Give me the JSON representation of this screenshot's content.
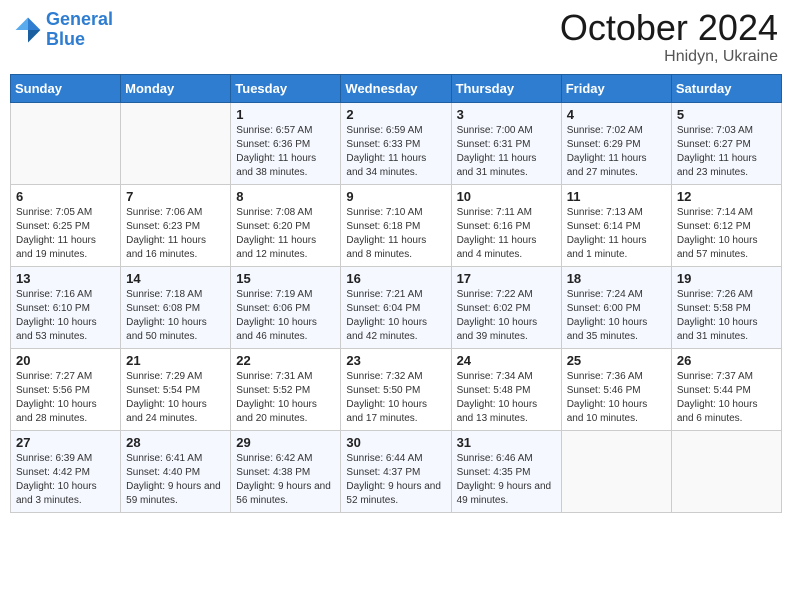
{
  "logo": {
    "text_general": "General",
    "text_blue": "Blue"
  },
  "header": {
    "month": "October 2024",
    "location": "Hnidyn, Ukraine"
  },
  "weekdays": [
    "Sunday",
    "Monday",
    "Tuesday",
    "Wednesday",
    "Thursday",
    "Friday",
    "Saturday"
  ],
  "weeks": [
    [
      {
        "day": "",
        "sunrise": "",
        "sunset": "",
        "daylight": ""
      },
      {
        "day": "",
        "sunrise": "",
        "sunset": "",
        "daylight": ""
      },
      {
        "day": "1",
        "sunrise": "Sunrise: 6:57 AM",
        "sunset": "Sunset: 6:36 PM",
        "daylight": "Daylight: 11 hours and 38 minutes."
      },
      {
        "day": "2",
        "sunrise": "Sunrise: 6:59 AM",
        "sunset": "Sunset: 6:33 PM",
        "daylight": "Daylight: 11 hours and 34 minutes."
      },
      {
        "day": "3",
        "sunrise": "Sunrise: 7:00 AM",
        "sunset": "Sunset: 6:31 PM",
        "daylight": "Daylight: 11 hours and 31 minutes."
      },
      {
        "day": "4",
        "sunrise": "Sunrise: 7:02 AM",
        "sunset": "Sunset: 6:29 PM",
        "daylight": "Daylight: 11 hours and 27 minutes."
      },
      {
        "day": "5",
        "sunrise": "Sunrise: 7:03 AM",
        "sunset": "Sunset: 6:27 PM",
        "daylight": "Daylight: 11 hours and 23 minutes."
      }
    ],
    [
      {
        "day": "6",
        "sunrise": "Sunrise: 7:05 AM",
        "sunset": "Sunset: 6:25 PM",
        "daylight": "Daylight: 11 hours and 19 minutes."
      },
      {
        "day": "7",
        "sunrise": "Sunrise: 7:06 AM",
        "sunset": "Sunset: 6:23 PM",
        "daylight": "Daylight: 11 hours and 16 minutes."
      },
      {
        "day": "8",
        "sunrise": "Sunrise: 7:08 AM",
        "sunset": "Sunset: 6:20 PM",
        "daylight": "Daylight: 11 hours and 12 minutes."
      },
      {
        "day": "9",
        "sunrise": "Sunrise: 7:10 AM",
        "sunset": "Sunset: 6:18 PM",
        "daylight": "Daylight: 11 hours and 8 minutes."
      },
      {
        "day": "10",
        "sunrise": "Sunrise: 7:11 AM",
        "sunset": "Sunset: 6:16 PM",
        "daylight": "Daylight: 11 hours and 4 minutes."
      },
      {
        "day": "11",
        "sunrise": "Sunrise: 7:13 AM",
        "sunset": "Sunset: 6:14 PM",
        "daylight": "Daylight: 11 hours and 1 minute."
      },
      {
        "day": "12",
        "sunrise": "Sunrise: 7:14 AM",
        "sunset": "Sunset: 6:12 PM",
        "daylight": "Daylight: 10 hours and 57 minutes."
      }
    ],
    [
      {
        "day": "13",
        "sunrise": "Sunrise: 7:16 AM",
        "sunset": "Sunset: 6:10 PM",
        "daylight": "Daylight: 10 hours and 53 minutes."
      },
      {
        "day": "14",
        "sunrise": "Sunrise: 7:18 AM",
        "sunset": "Sunset: 6:08 PM",
        "daylight": "Daylight: 10 hours and 50 minutes."
      },
      {
        "day": "15",
        "sunrise": "Sunrise: 7:19 AM",
        "sunset": "Sunset: 6:06 PM",
        "daylight": "Daylight: 10 hours and 46 minutes."
      },
      {
        "day": "16",
        "sunrise": "Sunrise: 7:21 AM",
        "sunset": "Sunset: 6:04 PM",
        "daylight": "Daylight: 10 hours and 42 minutes."
      },
      {
        "day": "17",
        "sunrise": "Sunrise: 7:22 AM",
        "sunset": "Sunset: 6:02 PM",
        "daylight": "Daylight: 10 hours and 39 minutes."
      },
      {
        "day": "18",
        "sunrise": "Sunrise: 7:24 AM",
        "sunset": "Sunset: 6:00 PM",
        "daylight": "Daylight: 10 hours and 35 minutes."
      },
      {
        "day": "19",
        "sunrise": "Sunrise: 7:26 AM",
        "sunset": "Sunset: 5:58 PM",
        "daylight": "Daylight: 10 hours and 31 minutes."
      }
    ],
    [
      {
        "day": "20",
        "sunrise": "Sunrise: 7:27 AM",
        "sunset": "Sunset: 5:56 PM",
        "daylight": "Daylight: 10 hours and 28 minutes."
      },
      {
        "day": "21",
        "sunrise": "Sunrise: 7:29 AM",
        "sunset": "Sunset: 5:54 PM",
        "daylight": "Daylight: 10 hours and 24 minutes."
      },
      {
        "day": "22",
        "sunrise": "Sunrise: 7:31 AM",
        "sunset": "Sunset: 5:52 PM",
        "daylight": "Daylight: 10 hours and 20 minutes."
      },
      {
        "day": "23",
        "sunrise": "Sunrise: 7:32 AM",
        "sunset": "Sunset: 5:50 PM",
        "daylight": "Daylight: 10 hours and 17 minutes."
      },
      {
        "day": "24",
        "sunrise": "Sunrise: 7:34 AM",
        "sunset": "Sunset: 5:48 PM",
        "daylight": "Daylight: 10 hours and 13 minutes."
      },
      {
        "day": "25",
        "sunrise": "Sunrise: 7:36 AM",
        "sunset": "Sunset: 5:46 PM",
        "daylight": "Daylight: 10 hours and 10 minutes."
      },
      {
        "day": "26",
        "sunrise": "Sunrise: 7:37 AM",
        "sunset": "Sunset: 5:44 PM",
        "daylight": "Daylight: 10 hours and 6 minutes."
      }
    ],
    [
      {
        "day": "27",
        "sunrise": "Sunrise: 6:39 AM",
        "sunset": "Sunset: 4:42 PM",
        "daylight": "Daylight: 10 hours and 3 minutes."
      },
      {
        "day": "28",
        "sunrise": "Sunrise: 6:41 AM",
        "sunset": "Sunset: 4:40 PM",
        "daylight": "Daylight: 9 hours and 59 minutes."
      },
      {
        "day": "29",
        "sunrise": "Sunrise: 6:42 AM",
        "sunset": "Sunset: 4:38 PM",
        "daylight": "Daylight: 9 hours and 56 minutes."
      },
      {
        "day": "30",
        "sunrise": "Sunrise: 6:44 AM",
        "sunset": "Sunset: 4:37 PM",
        "daylight": "Daylight: 9 hours and 52 minutes."
      },
      {
        "day": "31",
        "sunrise": "Sunrise: 6:46 AM",
        "sunset": "Sunset: 4:35 PM",
        "daylight": "Daylight: 9 hours and 49 minutes."
      },
      {
        "day": "",
        "sunrise": "",
        "sunset": "",
        "daylight": ""
      },
      {
        "day": "",
        "sunrise": "",
        "sunset": "",
        "daylight": ""
      }
    ]
  ]
}
